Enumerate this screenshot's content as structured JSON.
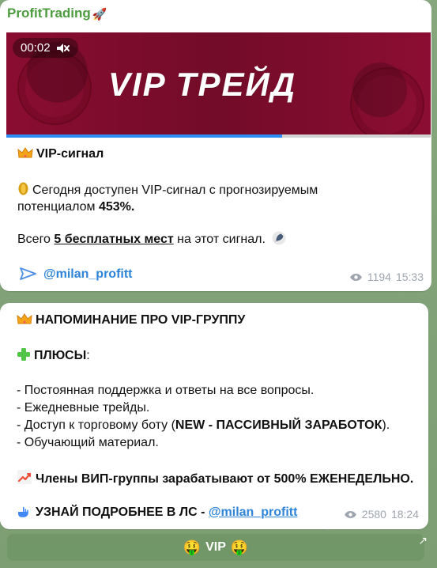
{
  "post1": {
    "channel": "ProfitTrading",
    "video_time": "00:02",
    "video_title": "VIP ТРЕЙД",
    "video_progress": 0.65,
    "heading": "VIP-сигнал",
    "line2a": "Сегодня доступен VIP-сигнал с прогнозируемым",
    "line2b_prefix": "потенциалом ",
    "line2b_value": "453%.",
    "line3_prefix": "Всего ",
    "line3_link": "5 бесплатных мест",
    "line3_suffix": " на этот сигнал.",
    "handle": "@milan_profitt",
    "views": "1194",
    "time": "15:33"
  },
  "post2": {
    "heading": "НАПОМИНАНИЕ ПРО VIP-ГРУППУ",
    "plus_label": "ПЛЮСЫ",
    "colon": ":",
    "bullet1": "- Постоянная поддержка и ответы на все вопросы.",
    "bullet2": "- Ежедневные трейды.",
    "bullet3_prefix": "- Доступ к торговому боту (",
    "bullet3_bold": "NEW - ПАССИВНЫЙ ЗАРАБОТОК",
    "bullet3_suffix": ").",
    "bullet4": "- Обучающий материал.",
    "earnings": "Члены ВИП-группы зарабатывают от 500% ЕЖЕНЕДЕЛЬНО.",
    "contact_prefix": "УЗНАЙ ПОДРОБНЕЕ В ЛС - ",
    "contact_link": "@milan_profitt",
    "views": "2580",
    "time": "18:24"
  },
  "button": {
    "emoji_left": "🤑",
    "label": "VIP",
    "emoji_right": "🤑",
    "corner_arrow": "↗"
  }
}
